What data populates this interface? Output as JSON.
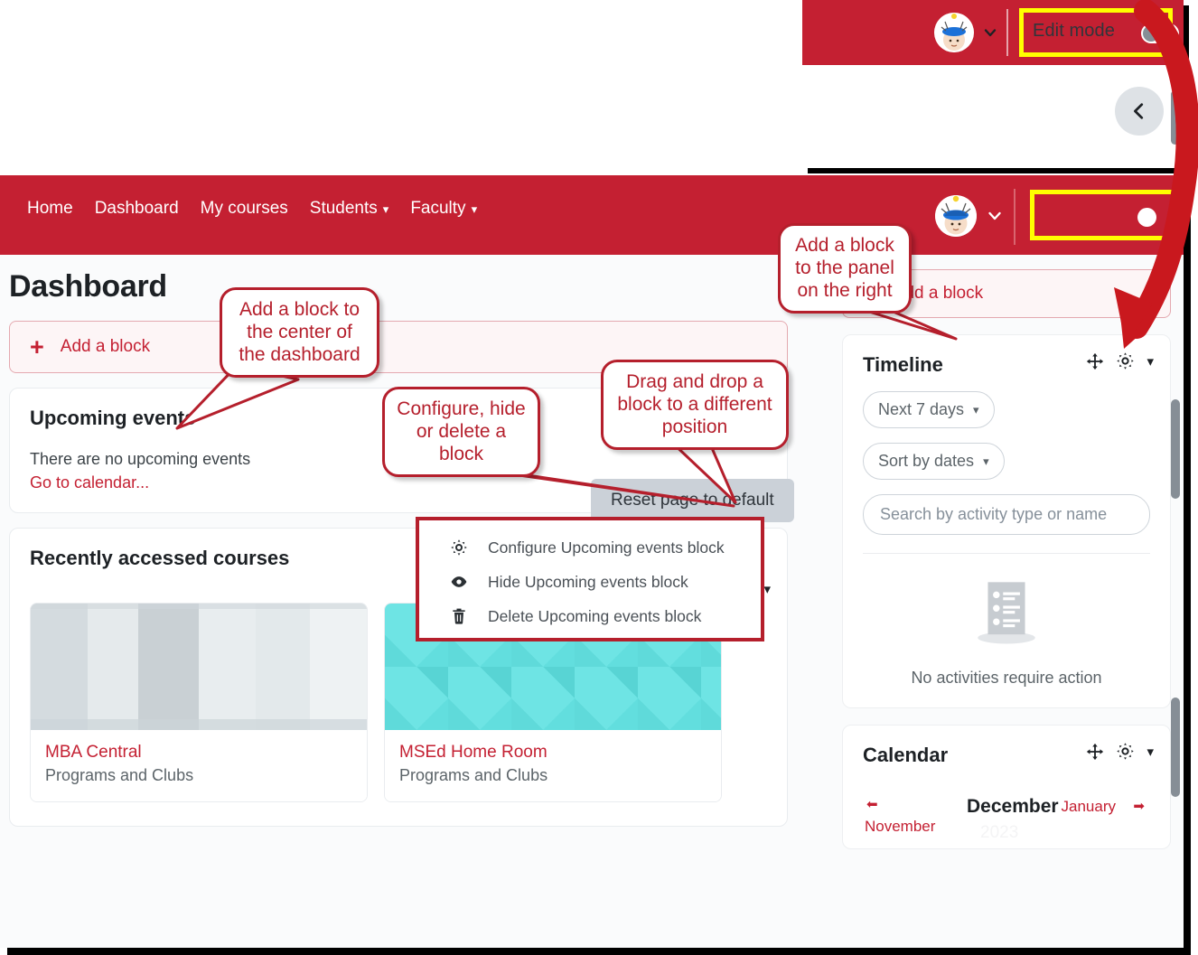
{
  "inset": {
    "edit_mode_label": "Edit mode",
    "avatar_name": "user-avatar",
    "collapse_icon": "chevron-left-icon"
  },
  "nav": {
    "links": [
      {
        "label": "Home",
        "has_caret": false
      },
      {
        "label": "Dashboard",
        "has_caret": false
      },
      {
        "label": "My courses",
        "has_caret": false
      },
      {
        "label": "Students",
        "has_caret": true
      },
      {
        "label": "Faculty",
        "has_caret": true
      }
    ],
    "brand_color": "#c42032",
    "highlight_color": "#ffff00"
  },
  "page": {
    "title": "Dashboard",
    "reset_button": "Reset page to default",
    "add_block_center": "Add a block",
    "add_block_right": "Add a block"
  },
  "upcoming_events": {
    "title": "Upcoming events",
    "body": "There are no upcoming events",
    "link": "Go to calendar..."
  },
  "block_menu": {
    "items": [
      {
        "icon": "gear-icon",
        "label": "Configure Upcoming events block"
      },
      {
        "icon": "eye-icon",
        "label": "Hide Upcoming events block"
      },
      {
        "icon": "trash-icon",
        "label": "Delete Upcoming events block"
      }
    ]
  },
  "recently_accessed": {
    "title": "Recently accessed courses",
    "prev_label": "‹",
    "next_label": "›",
    "courses": [
      {
        "name": "MBA Central",
        "category": "Programs and Clubs",
        "image": "gray-tile-pattern"
      },
      {
        "name": "MSEd Home Room",
        "category": "Programs and Clubs",
        "image": "teal-tile-pattern"
      }
    ]
  },
  "timeline": {
    "title": "Timeline",
    "filter_dates": "Next 7 days",
    "sort": "Sort by dates",
    "search_placeholder": "Search by activity type or name",
    "empty_text": "No activities require action"
  },
  "calendar": {
    "title": "Calendar",
    "prev_month": "November",
    "current_month": "December",
    "year": "2023",
    "next_month": "January"
  },
  "callouts": [
    {
      "id": "center-block",
      "text": "Add a block to the center of the dashboard"
    },
    {
      "id": "configure-block",
      "text": "Configure, hide or delete a block"
    },
    {
      "id": "drag-drop",
      "text": "Drag and drop a block to a different position"
    },
    {
      "id": "right-panel-block",
      "text": "Add a block to the panel on the right"
    }
  ]
}
